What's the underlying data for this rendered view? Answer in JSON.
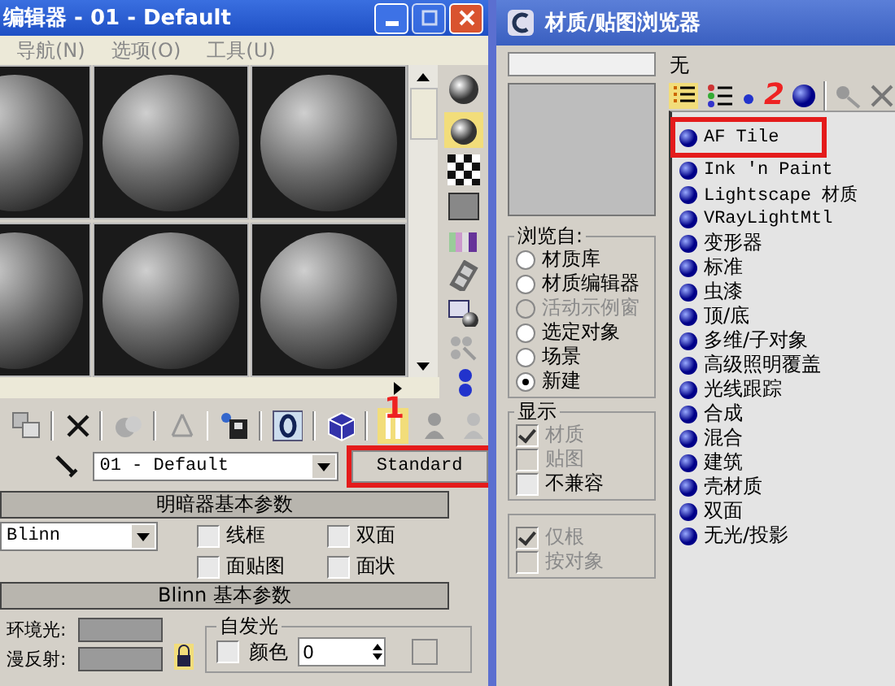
{
  "material_editor": {
    "title": "编辑器 - 01 - Default",
    "menu": [
      "导航(N)",
      "选项(O)",
      "工具(U)"
    ],
    "material_name": "01 - Default",
    "type_button": "Standard",
    "callout": "1",
    "shader_rollout": {
      "title": "明暗器基本参数",
      "shader": "Blinn",
      "options": [
        {
          "label": "线框",
          "checked": false
        },
        {
          "label": "双面",
          "checked": false
        },
        {
          "label": "面贴图",
          "checked": false
        },
        {
          "label": "面状",
          "checked": false
        }
      ]
    },
    "blinn_rollout": {
      "title": "Blinn 基本参数",
      "color_labels": [
        "环境光:",
        "漫反射:"
      ],
      "self_illum": {
        "title": "自发光",
        "label": "颜色",
        "checked": false,
        "value": "0"
      }
    }
  },
  "browser": {
    "title": "材质/贴图浏览器",
    "current": "无",
    "callout": "2",
    "browse_from": {
      "title": "浏览自:",
      "options": [
        {
          "label": "材质库",
          "selected": false,
          "disabled": false
        },
        {
          "label": "材质编辑器",
          "selected": false,
          "disabled": false
        },
        {
          "label": "活动示例窗",
          "selected": false,
          "disabled": true
        },
        {
          "label": "选定对象",
          "selected": false,
          "disabled": false
        },
        {
          "label": "场景",
          "selected": false,
          "disabled": false
        },
        {
          "label": "新建",
          "selected": true,
          "disabled": false
        }
      ]
    },
    "display": {
      "title": "显示",
      "options": [
        {
          "label": "材质",
          "checked": true,
          "disabled": true
        },
        {
          "label": "贴图",
          "checked": false,
          "disabled": true
        },
        {
          "label": "不兼容",
          "checked": false,
          "disabled": false
        }
      ]
    },
    "filter": {
      "options": [
        {
          "label": "仅根",
          "checked": true,
          "disabled": true
        },
        {
          "label": "按对象",
          "checked": false,
          "disabled": true
        }
      ]
    },
    "materials": [
      {
        "label": "AF Tile",
        "selected": true
      },
      {
        "label": "Ink 'n Paint",
        "selected": false
      },
      {
        "label": "Lightscape 材质",
        "selected": false
      },
      {
        "label": "VRayLightMtl",
        "selected": false
      },
      {
        "label": "变形器",
        "selected": false
      },
      {
        "label": "标准",
        "selected": false
      },
      {
        "label": "虫漆",
        "selected": false
      },
      {
        "label": "顶/底",
        "selected": false
      },
      {
        "label": "多维/子对象",
        "selected": false
      },
      {
        "label": "高级照明覆盖",
        "selected": false
      },
      {
        "label": "光线跟踪",
        "selected": false
      },
      {
        "label": "合成",
        "selected": false
      },
      {
        "label": "混合",
        "selected": false
      },
      {
        "label": "建筑",
        "selected": false
      },
      {
        "label": "壳材质",
        "selected": false
      },
      {
        "label": "双面",
        "selected": false
      },
      {
        "label": "无光/投影",
        "selected": false
      }
    ]
  }
}
